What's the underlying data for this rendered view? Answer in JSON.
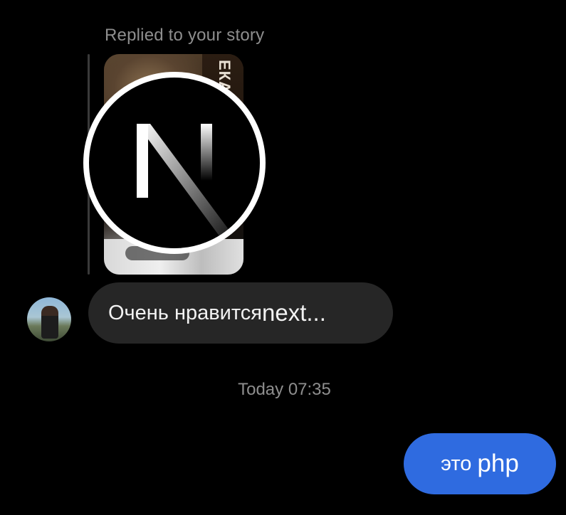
{
  "story_reply": {
    "label": "Replied to your story",
    "thumbnail_side_text": "ЕКАР НСК"
  },
  "logo": {
    "letter": "N",
    "icon": "nextjs-logo"
  },
  "incoming_message": {
    "cyrillic": "Очень нравится ",
    "latin": "next..."
  },
  "timestamp": "Today 07:35",
  "outgoing_message": {
    "cyrillic": "это",
    "latin": "php"
  },
  "colors": {
    "background": "#000000",
    "incoming_bubble": "#262626",
    "outgoing_bubble": "#2f6be0",
    "muted_text": "#8e8e8e"
  }
}
